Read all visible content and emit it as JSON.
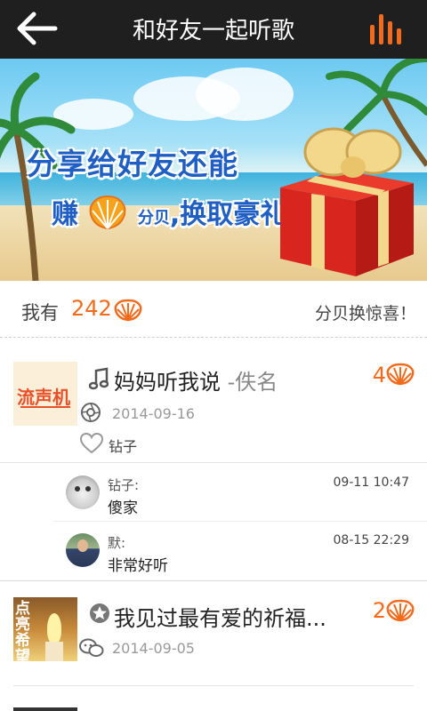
{
  "header": {
    "title": "和好友一起听歌"
  },
  "banner": {
    "line1": "分享给好友还能",
    "line2_a": "赚",
    "line2_b": "分贝",
    "line2_c": ",换取豪礼"
  },
  "balance": {
    "label": "我有",
    "count": "242",
    "exchange_link": "分贝换惊喜！"
  },
  "items": [
    {
      "song": "妈妈听我说",
      "artist": "-佚名",
      "date": "2014-09-16",
      "count": "4",
      "like_name": "钻子",
      "thumb_text": "流声机",
      "comments": [
        {
          "name": "钻子:",
          "text": "傻家",
          "time": "09-11 10:47"
        },
        {
          "name": "默:",
          "text": "非常好听",
          "time": "08-15 22:29"
        }
      ]
    },
    {
      "song": "我见过最有爱的祈福...",
      "date": "2014-09-05",
      "count": "2",
      "thumb_text": "点亮希望"
    }
  ],
  "colors": {
    "accent": "#f26a1b",
    "topbar": "#1f1f1f"
  }
}
